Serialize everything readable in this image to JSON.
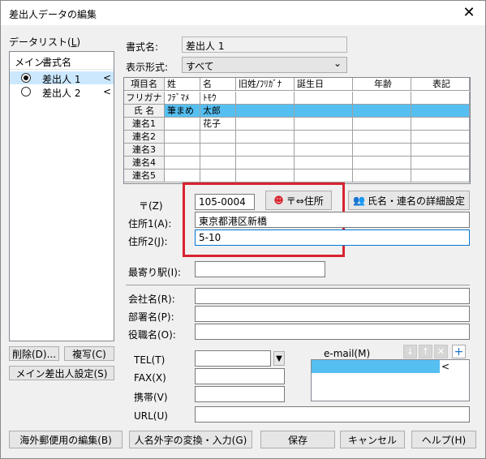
{
  "window": {
    "title": "差出人データの編集",
    "close_glyph": "✕"
  },
  "left": {
    "list_label": "データリスト(",
    "list_key": "L",
    "list_label_end": ")",
    "header_main": "メイン",
    "header_format": "書式名",
    "items": [
      {
        "name": "差出人 1",
        "selected": true,
        "arrow": "<"
      },
      {
        "name": "差出人 2",
        "selected": false,
        "arrow": "<"
      }
    ],
    "delete_button": "削除(D)...",
    "copy_button": "複写(C)",
    "main_sender_button": "メイン差出人設定(S)"
  },
  "form": {
    "format_name_label": "書式名:",
    "format_name_value": "差出人 1",
    "display_format_label": "表示形式:",
    "display_format_value": "すべて",
    "dropdown_glyph": "⌄"
  },
  "grid": {
    "headers": [
      "項目名",
      "姓",
      "名",
      "旧姓/ﾌﾘｶﾞﾅ",
      "誕生日",
      "年齢",
      "表記"
    ],
    "rows": [
      {
        "label": "フリガナ",
        "cells": [
          "ﾌﾃﾞﾏﾒ",
          "ﾄﾓｳ",
          "",
          "",
          "",
          ""
        ],
        "selected": false
      },
      {
        "label": "氏 名",
        "cells": [
          "筆まめ",
          "太郎",
          "",
          "",
          "",
          ""
        ],
        "selected": true
      },
      {
        "label": "連名1",
        "cells": [
          "",
          "花子",
          "",
          "",
          "",
          ""
        ],
        "selected": false
      },
      {
        "label": "連名2",
        "cells": [
          "",
          "",
          "",
          "",
          "",
          ""
        ],
        "selected": false
      },
      {
        "label": "連名3",
        "cells": [
          "",
          "",
          "",
          "",
          "",
          ""
        ],
        "selected": false
      },
      {
        "label": "連名4",
        "cells": [
          "",
          "",
          "",
          "",
          "",
          ""
        ],
        "selected": false
      },
      {
        "label": "連名5",
        "cells": [
          "",
          "",
          "",
          "",
          "",
          ""
        ],
        "selected": false
      }
    ]
  },
  "address": {
    "zip_label": "〒(Z)",
    "zip_value": "105-0004",
    "zip_addr_button": "〒⇔住所",
    "name_detail_button": "氏名・連名の詳細設定",
    "addr1_label": "住所1(A):",
    "addr1_value": "東京都港区新橋",
    "addr2_label": "住所2(J):",
    "addr2_value": "5-10",
    "station_label": "最寄り駅(I):",
    "station_value": ""
  },
  "company": {
    "company_label": "会社名(R):",
    "dept_label": "部署名(P):",
    "title_label": "役職名(O):"
  },
  "contact": {
    "tel_label": "TEL(T)",
    "fax_label": "FAX(X)",
    "mobile_label": "携帯(V)",
    "url_label": "URL(U)",
    "email_label": "e-mail(M)",
    "email_down": "↓",
    "email_up": "↑",
    "email_delete": "✕",
    "email_add": "+",
    "email_arrow": "<"
  },
  "footer": {
    "overseas_button": "海外郵便用の編集(B)",
    "gaiji_button": "人名外字の変換・入力(G)",
    "save_button": "保存",
    "cancel_button": "キャンセル",
    "help_button": "ヘルプ(H)"
  },
  "colors": {
    "highlight": "#56bff1",
    "list_selected": "#cce8ff",
    "callout": "#d9232f"
  }
}
